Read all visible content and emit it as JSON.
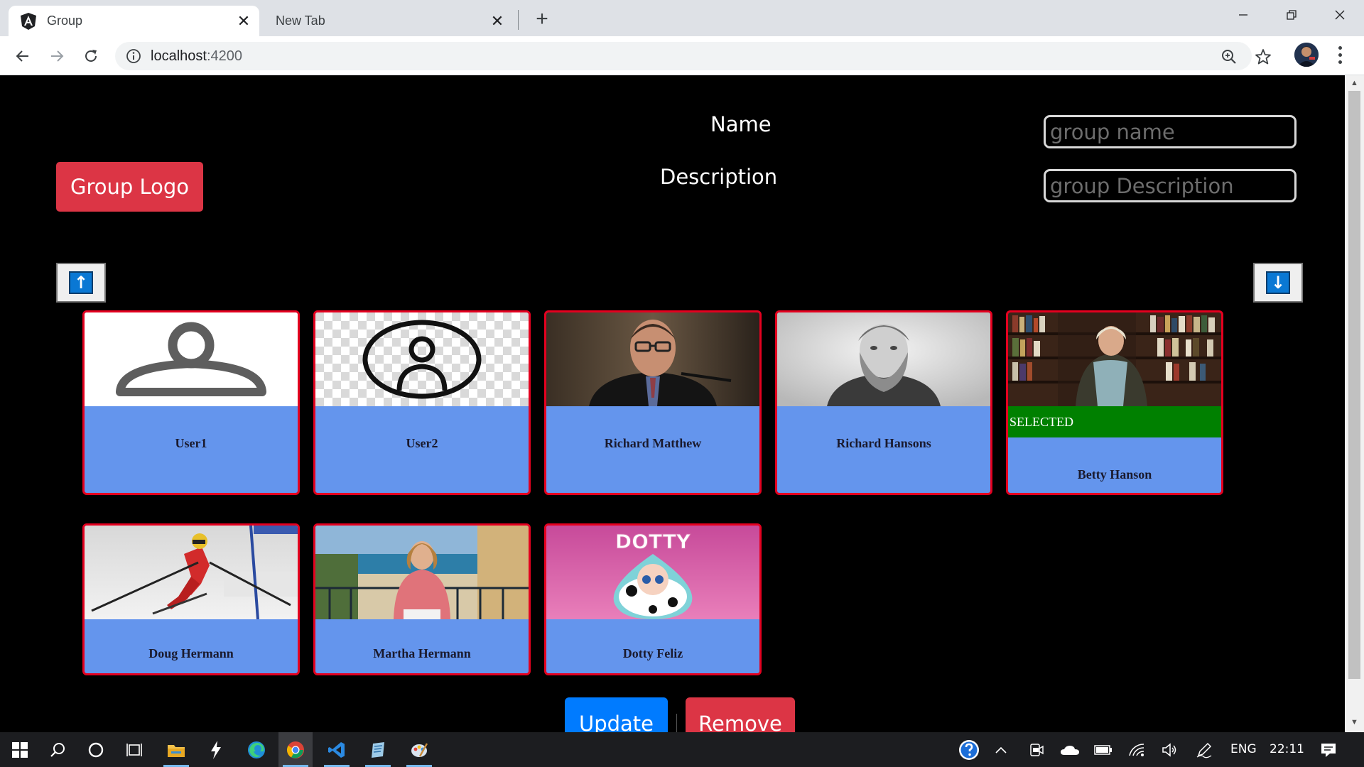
{
  "browser": {
    "tabs": [
      {
        "title": "Group",
        "active": true
      },
      {
        "title": "New Tab",
        "active": false
      }
    ],
    "url_host": "localhost",
    "url_port": ":4200"
  },
  "form": {
    "name_label": "Name",
    "description_label": "Description",
    "name_placeholder": "group name",
    "description_placeholder": "group Description",
    "logo_button": "Group Logo"
  },
  "sort": {
    "up_glyph": "↑",
    "down_glyph": "↓"
  },
  "members": [
    {
      "name": "User1",
      "selected": false,
      "photo": "user-outline"
    },
    {
      "name": "User2",
      "selected": false,
      "photo": "user-circle"
    },
    {
      "name": "Richard Matthew",
      "selected": false,
      "photo": "man-speaking"
    },
    {
      "name": "Richard Hansons",
      "selected": false,
      "photo": "bearded-man"
    },
    {
      "name": "Betty Hanson",
      "selected": true,
      "photo": "woman-bookshelf"
    },
    {
      "name": "Doug Hermann",
      "selected": false,
      "photo": "skier"
    },
    {
      "name": "Martha Hermann",
      "selected": false,
      "photo": "woman-balcony"
    },
    {
      "name": "Dotty Feliz",
      "selected": false,
      "photo": "dotty-doll"
    }
  ],
  "selected_label": "SELECTED",
  "dotty_text": "DOTTY",
  "actions": {
    "update": "Update",
    "remove": "Remove"
  },
  "taskbar": {
    "language": "ENG",
    "time": "22:11"
  },
  "colors": {
    "card_bg": "#6495ed",
    "card_border": "#e4001f",
    "selected_bar": "#008000",
    "danger": "#dc3545",
    "primary": "#007bff"
  }
}
